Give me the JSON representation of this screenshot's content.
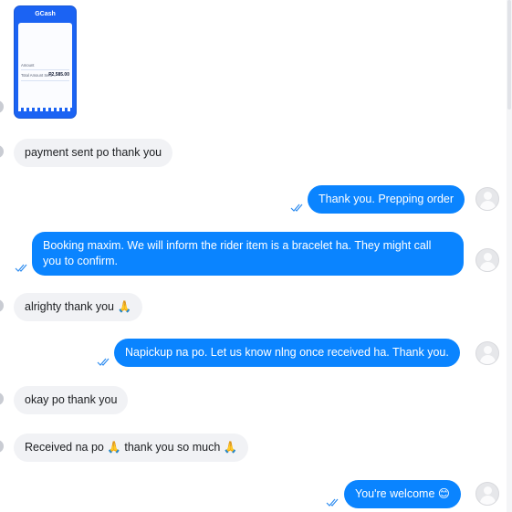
{
  "payment_preview": {
    "brand": "GCash",
    "amount_label": "Total Amount Sent",
    "amount": "P2,585.00",
    "row_label": "Amount"
  },
  "messages": [
    {
      "side": "in",
      "text": "payment sent po thank you"
    },
    {
      "side": "out",
      "text": "Thank you. Prepping order"
    },
    {
      "side": "out",
      "text": "Booking maxim. We will inform the rider item is a bracelet ha. They might call you to confirm."
    },
    {
      "side": "in",
      "text": "alrighty thank you 🙏"
    },
    {
      "side": "out",
      "text": "Napickup na po. Let us know nlng once received ha. Thank you."
    },
    {
      "side": "in",
      "text": "okay po thank you"
    },
    {
      "side": "in",
      "text": "Received na po 🙏 thank you so much 🙏"
    },
    {
      "side": "out",
      "text": "You're welcome 😊"
    }
  ],
  "colors": {
    "outgoing_bubble": "#0a84ff",
    "incoming_bubble": "#f1f2f5",
    "read_check": "#2d8cf0"
  }
}
